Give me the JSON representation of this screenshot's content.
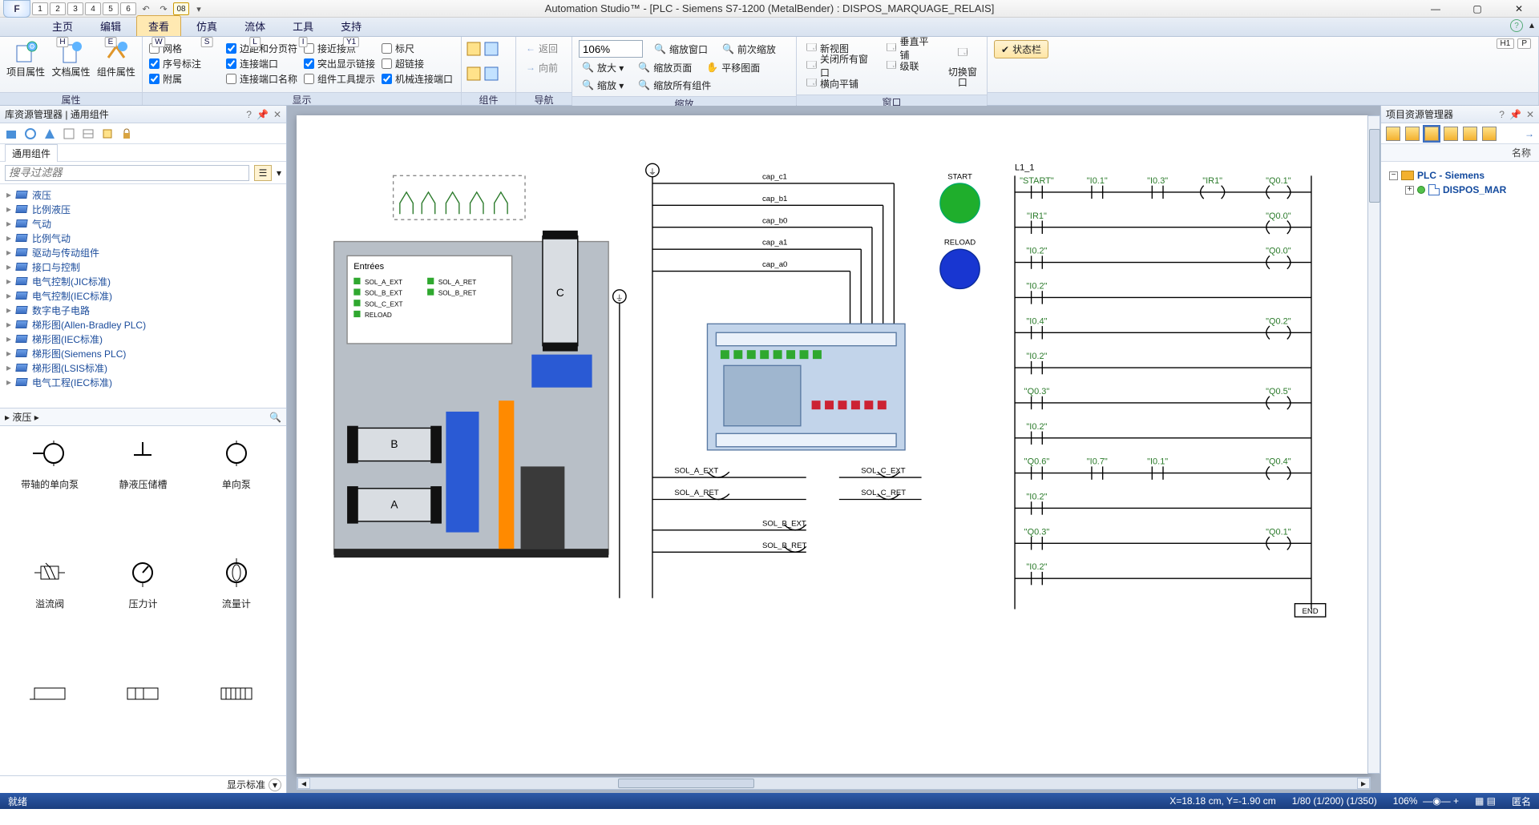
{
  "title": "Automation Studio™ - [PLC - Siemens S7-1200 (MetalBender) : DISPOS_MARQUAGE_RELAIS]",
  "menu": {
    "tabs": [
      "主页",
      "编辑",
      "查看",
      "仿真",
      "流体",
      "工具",
      "支持"
    ],
    "keys": [
      "H",
      "E",
      "W",
      "S",
      "L",
      "I",
      "Y1"
    ],
    "rightkeys": [
      "H1",
      "P"
    ],
    "active": 2
  },
  "ribbon": {
    "g_props": {
      "label": "属性",
      "btns": [
        "项目属性",
        "文档属性",
        "组件属性"
      ]
    },
    "g_disp": {
      "label": "显示",
      "col1": [
        "网格",
        "序号标注",
        "附属"
      ],
      "col2": [
        "边距和分页符",
        "连接端口",
        "连接端口名称"
      ],
      "col3": [
        "接近接点",
        "突出显示链接",
        "组件工具提示"
      ],
      "col4": [
        "标尺",
        "超链接",
        "机械连接端口"
      ],
      "checked": [
        "边距和分页符",
        "序号标注",
        "附属",
        "连接端口",
        "突出显示链接",
        "机械连接端口"
      ]
    },
    "g_comp": {
      "label": "组件"
    },
    "g_nav": {
      "label": "导航",
      "back": "返回",
      "fwd": "向前"
    },
    "g_zoom": {
      "label": "缩放",
      "value": "106%",
      "cmds": [
        "放大 ▾",
        "缩放 ▾",
        "缩放窗口",
        "缩放页面",
        "缩放所有组件",
        "前次缩放",
        "平移图面"
      ]
    },
    "g_win": {
      "label": "窗口",
      "cmds": [
        "新视图",
        "关闭所有窗口",
        "横向平铺",
        "垂直平铺",
        "级联",
        "切换窗口"
      ]
    },
    "g_stat": {
      "btn": "状态栏"
    }
  },
  "left": {
    "title": "库资源管理器 | 通用组件",
    "subtab": "通用组件",
    "search_ph": "搜寻过滤器",
    "tree": [
      "液压",
      "比例液压",
      "气动",
      "比例气动",
      "驱动与传动组件",
      "接口与控制",
      "电气控制(JIC标准)",
      "电气控制(IEC标准)",
      "数字电子电路",
      "梯形图(Allen-Bradley PLC)",
      "梯形图(IEC标准)",
      "梯形图(Siemens PLC)",
      "梯形图(LSIS标准)",
      "电气工程(IEC标准)"
    ],
    "catbar": "液压",
    "palette": [
      "带轴的单向泵",
      "静液压储槽",
      "单向泵",
      "溢流阀",
      "压力计",
      "流量计",
      "",
      "",
      ""
    ],
    "foot": "显示标准"
  },
  "right": {
    "title": "项目资源管理器",
    "colhdr": "名称",
    "nodes": [
      {
        "lvl": 0,
        "label": "PLC - Siemens"
      },
      {
        "lvl": 1,
        "label": "DISPOS_MAR"
      }
    ]
  },
  "canvas": {
    "entrees_title": "Entrées",
    "entrees": [
      "SOL_A_EXT",
      "SOL_B_EXT",
      "SOL_C_EXT",
      "RELOAD",
      "SOL_A_RET",
      "SOL_B_RET"
    ],
    "bus_caps": [
      "cap_c1",
      "cap_b1",
      "cap_b0",
      "cap_a1",
      "cap_a0"
    ],
    "btn_labels": [
      "START",
      "RELOAD"
    ],
    "coils": [
      "SOL_A_EXT",
      "SOL_A_RET",
      "SOL_B_EXT",
      "SOL_B_RET",
      "SOL_C_EXT",
      "SOL_C_RET"
    ],
    "cyl": [
      "A",
      "B",
      "C"
    ],
    "ladder_net": "L1_1",
    "rungs": [
      {
        "l": [
          "\"START\"",
          "\"I0.1\"",
          "\"I0.3\""
        ],
        "r": [
          "\"Q0.1\"",
          "\"IR1\""
        ]
      },
      {
        "l": [
          "\"IR1\""
        ],
        "r": [
          "\"Q0.0\""
        ]
      },
      {
        "l": [
          "\"I0.2\""
        ],
        "r": [
          "\"Q0.0\""
        ]
      },
      {
        "l": [
          "\"I0.2\""
        ],
        "r": []
      },
      {
        "l": [
          "\"I0.4\""
        ],
        "r": [
          "\"Q0.2\""
        ]
      },
      {
        "l": [
          "\"I0.2\""
        ],
        "r": []
      },
      {
        "l": [
          "\"Q0.3\""
        ],
        "r": [
          "\"Q0.5\""
        ]
      },
      {
        "l": [
          "\"I0.2\""
        ],
        "r": []
      },
      {
        "l": [
          "\"Q0.6\"",
          "\"I0.7\"",
          "\"I0.1\""
        ],
        "r": [
          "\"Q0.4\""
        ]
      },
      {
        "l": [
          "\"I0.2\""
        ],
        "r": []
      },
      {
        "l": [
          "\"Q0.3\""
        ],
        "r": [
          "\"Q0.1\""
        ]
      },
      {
        "l": [
          "\"I0.2\""
        ],
        "r": []
      }
    ],
    "end": "END"
  },
  "status": {
    "ready": "就绪",
    "coords": "X=18.18 cm, Y=-1.90 cm",
    "pages": "1/80 (1/200) (1/350)",
    "zoom": "106%",
    "anon": "匿名"
  },
  "qat_nums": [
    "1",
    "2",
    "3",
    "4",
    "5",
    "6",
    "08"
  ]
}
